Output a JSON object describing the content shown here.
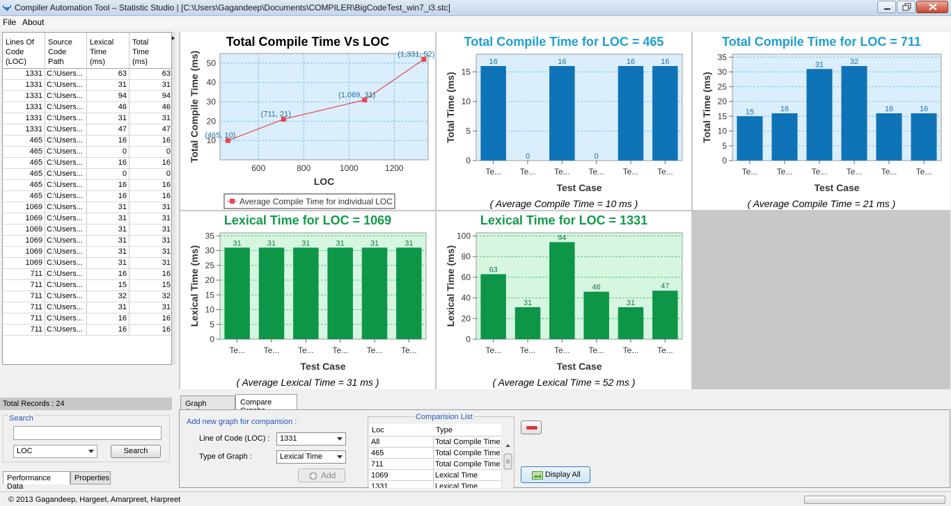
{
  "window": {
    "title": "Compiler Automation Tool – Statistic Studio | [C:\\Users\\Gagandeep\\Documents\\COMPILER\\BigCodeTest_win7_i3.stc]"
  },
  "menu": {
    "file": "File",
    "about": "About"
  },
  "records_table": {
    "headers": [
      "Lines Of\nCode\n(LOC)",
      "Source\nCode\nPath",
      "Lexical\nTime\n(ms)",
      "Total\nTime\n(ms)"
    ],
    "rows": [
      [
        "1331",
        "C:\\Users...",
        "63",
        "63"
      ],
      [
        "1331",
        "C:\\Users...",
        "31",
        "31"
      ],
      [
        "1331",
        "C:\\Users...",
        "94",
        "94"
      ],
      [
        "1331",
        "C:\\Users...",
        "46",
        "46"
      ],
      [
        "1331",
        "C:\\Users...",
        "31",
        "31"
      ],
      [
        "1331",
        "C:\\Users...",
        "47",
        "47"
      ],
      [
        "465",
        "C:\\Users...",
        "16",
        "16"
      ],
      [
        "465",
        "C:\\Users...",
        "0",
        "0"
      ],
      [
        "465",
        "C:\\Users...",
        "16",
        "16"
      ],
      [
        "465",
        "C:\\Users...",
        "0",
        "0"
      ],
      [
        "465",
        "C:\\Users...",
        "16",
        "16"
      ],
      [
        "465",
        "C:\\Users...",
        "16",
        "16"
      ],
      [
        "1069",
        "C:\\Users...",
        "31",
        "31"
      ],
      [
        "1069",
        "C:\\Users...",
        "31",
        "31"
      ],
      [
        "1069",
        "C:\\Users...",
        "31",
        "31"
      ],
      [
        "1069",
        "C:\\Users...",
        "31",
        "31"
      ],
      [
        "1069",
        "C:\\Users...",
        "31",
        "31"
      ],
      [
        "1069",
        "C:\\Users...",
        "31",
        "31"
      ],
      [
        "711",
        "C:\\Users...",
        "16",
        "16"
      ],
      [
        "711",
        "C:\\Users...",
        "15",
        "15"
      ],
      [
        "711",
        "C:\\Users...",
        "32",
        "32"
      ],
      [
        "711",
        "C:\\Users...",
        "31",
        "31"
      ],
      [
        "711",
        "C:\\Users...",
        "16",
        "16"
      ],
      [
        "711",
        "C:\\Users...",
        "16",
        "16"
      ]
    ]
  },
  "total_records": "Total Records : 24",
  "search": {
    "legend": "Search",
    "query": "",
    "field_selected": "LOC",
    "button": "Search"
  },
  "left_tabs": [
    "Performance Data",
    "Properties"
  ],
  "bottom_tabs": [
    "Graph Options",
    "Compare Graphs"
  ],
  "compare": {
    "add_label": "Add new graph for comparision :",
    "loc_label": "Line of Code (LOC) :",
    "loc_value": "1331",
    "type_label": "Type of Graph :",
    "type_value": "Lexical Time",
    "add_button": "Add",
    "list_legend": "Comparision List",
    "list_headers": [
      "Loc",
      "Type"
    ],
    "list_rows": [
      [
        "All",
        "Total Compile Time"
      ],
      [
        "465",
        "Total Compile Time"
      ],
      [
        "711",
        "Total Compile Time"
      ],
      [
        "1069",
        "Lexical Time"
      ],
      [
        "1331",
        "Lexical Time"
      ]
    ],
    "display_button": "Display All"
  },
  "status": {
    "copyright": "© 2013 Gagandeep, Hargeet, Amarpreet, Harpreet"
  },
  "colors": {
    "total_title": "#1ea0d2",
    "total_bar": "#0e73b7",
    "lexical_title": "#139b4a",
    "lexical_bar": "#0e9648",
    "total_plot_bg": "#dbeefb",
    "lexical_plot_bg": "#d7f6e2",
    "line_color": "#e8454f"
  },
  "chart_data": [
    {
      "type": "line",
      "title": "Total Compile Time Vs LOC",
      "xlabel": "LOC",
      "ylabel": "Total Compile Time (ms)",
      "x": [
        465,
        711,
        1069,
        1331
      ],
      "y": [
        10,
        21,
        31,
        52
      ],
      "point_labels": [
        "(465, 10)",
        "(711, 21)",
        "(1,069, 31)",
        "(1,331, 52)"
      ],
      "xticks": [
        "600",
        "800",
        "1000",
        "1200"
      ],
      "yticks": [
        "10",
        "20",
        "30",
        "40",
        "50"
      ],
      "xlim": [
        430,
        1350
      ],
      "ylim": [
        0,
        55
      ],
      "legend": "Average Compile Time for individual LOC",
      "grid": true
    },
    {
      "type": "bar",
      "title": "Total Compile Time for LOC = 465",
      "xlabel": "Test Case",
      "ylabel": "Total Time (ms)",
      "categories": [
        "Te...",
        "Te...",
        "Te...",
        "Te...",
        "Te...",
        "Te..."
      ],
      "values": [
        16,
        0,
        16,
        0,
        16,
        16
      ],
      "yticks": [
        "0",
        "5",
        "10",
        "15"
      ],
      "ylim": [
        0,
        18
      ],
      "average": "( Average Compile Time = 10 ms )",
      "grid": true
    },
    {
      "type": "bar",
      "title": "Total Compile Time for LOC = 711",
      "xlabel": "Test Case",
      "ylabel": "Total Time (ms)",
      "categories": [
        "Te...",
        "Te...",
        "Te...",
        "Te...",
        "Te...",
        "Te..."
      ],
      "values": [
        15,
        16,
        31,
        32,
        16,
        16
      ],
      "yticks": [
        "0",
        "5",
        "10",
        "15",
        "20",
        "25",
        "30",
        "35"
      ],
      "ylim": [
        0,
        36
      ],
      "average": "( Average Compile Time = 21 ms )",
      "grid": true
    },
    {
      "type": "bar",
      "title": "Lexical Time for LOC = 1069",
      "xlabel": "Test Case",
      "ylabel": "Lexical Time (ms)",
      "categories": [
        "Te...",
        "Te...",
        "Te...",
        "Te...",
        "Te...",
        "Te..."
      ],
      "values": [
        31,
        31,
        31,
        31,
        31,
        31
      ],
      "yticks": [
        "0",
        "5",
        "10",
        "15",
        "20",
        "25",
        "30",
        "35"
      ],
      "ylim": [
        0,
        36
      ],
      "average": "( Average Lexical Time = 31 ms )",
      "grid": true
    },
    {
      "type": "bar",
      "title": "Lexical Time for LOC = 1331",
      "xlabel": "Test Case",
      "ylabel": "Lexical Time (ms)",
      "categories": [
        "Te...",
        "Te...",
        "Te...",
        "Te...",
        "Te...",
        "Te..."
      ],
      "values": [
        63,
        31,
        94,
        46,
        31,
        47
      ],
      "yticks": [
        "0",
        "20",
        "40",
        "60",
        "80",
        "100"
      ],
      "ylim": [
        0,
        103
      ],
      "average": "( Average Lexical Time = 52 ms )",
      "grid": true
    }
  ]
}
